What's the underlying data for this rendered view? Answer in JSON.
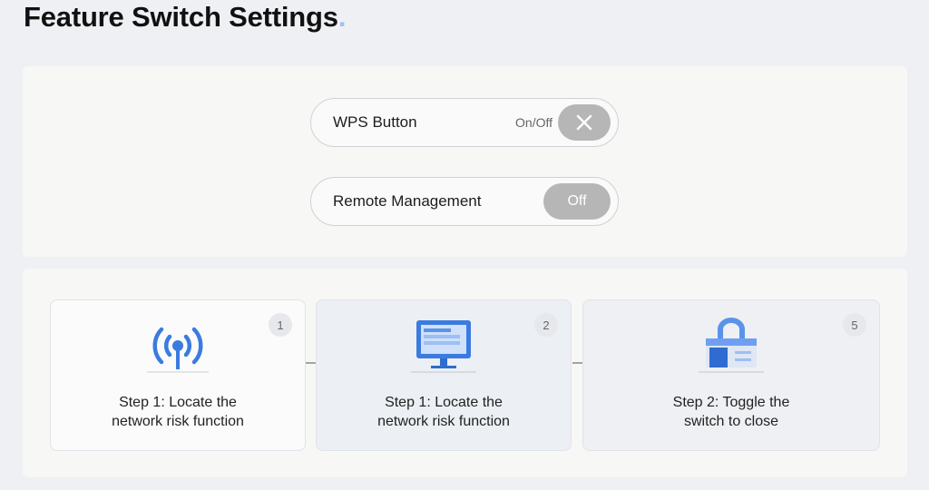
{
  "page": {
    "title": "Feature Switch Settings",
    "title_dot": "."
  },
  "switches": [
    {
      "label": "WPS Button",
      "sublabel": "On/Off",
      "state_icon": "close-x-icon"
    },
    {
      "label": "Remote Management",
      "state_label": "Off"
    }
  ],
  "steps": [
    {
      "number": "1",
      "icon": "antenna-signal-icon",
      "line1": "Step 1: Locate the",
      "line2": "network risk function"
    },
    {
      "number": "2",
      "icon": "monitor-icon",
      "line1": "Step 1: Locate the",
      "line2": "network risk function"
    },
    {
      "number": "5",
      "icon": "router-lock-icon",
      "line1": "Step 2: Toggle the",
      "line2": "switch to close"
    }
  ],
  "colors": {
    "accent_blue": "#3b7be0",
    "toggle_gray": "#b6b6b6",
    "background": "#eef0f3"
  }
}
